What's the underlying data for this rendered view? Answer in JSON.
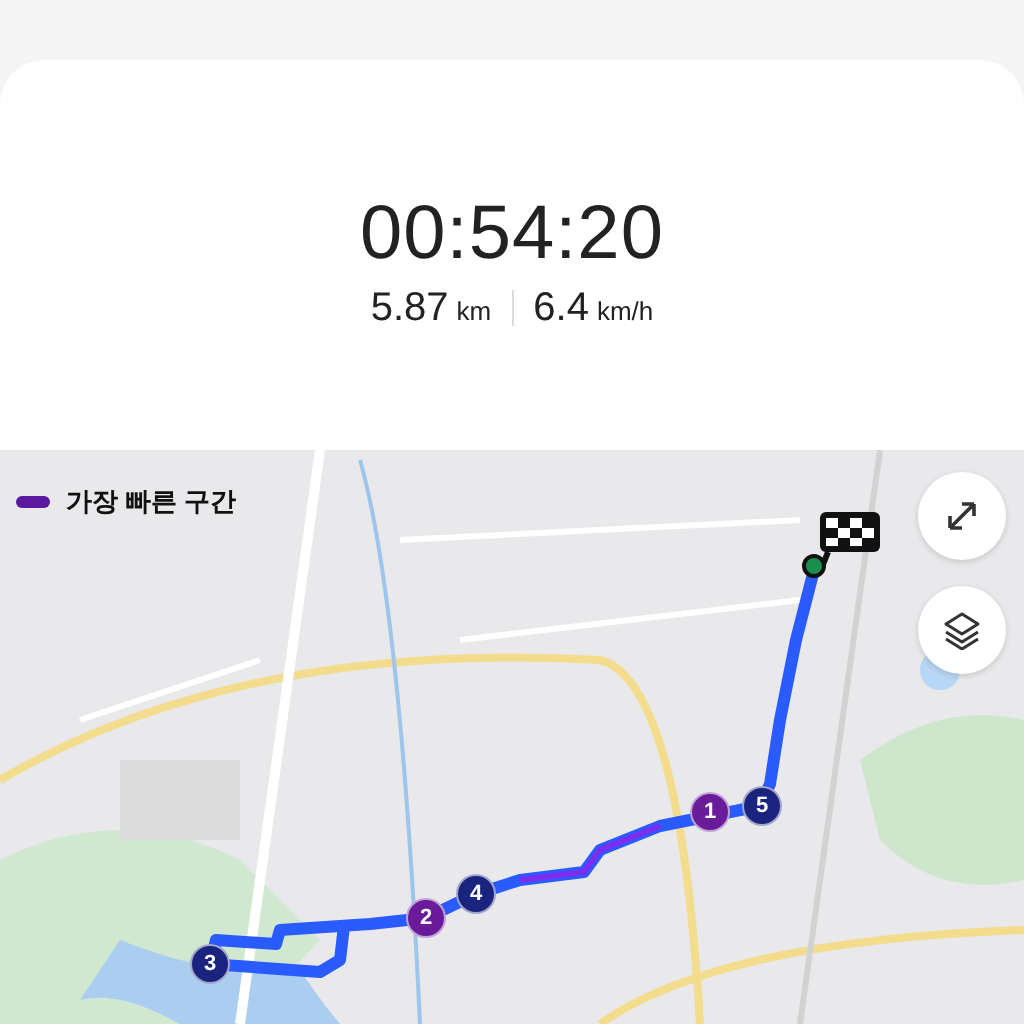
{
  "summary": {
    "duration": "00:54:20",
    "distance": "5.87",
    "distance_unit": "km",
    "speed": "6.4",
    "speed_unit": "km/h"
  },
  "map": {
    "kind": "picture",
    "legend": {
      "label": "가장 빠른 구간",
      "color": "#5b1a9e"
    },
    "markers": [
      {
        "label": "1",
        "color": "#6a1b9a"
      },
      {
        "label": "5",
        "color": "#1a237e"
      },
      {
        "label": "2",
        "color": "#6a1b9a"
      },
      {
        "label": "4",
        "color": "#1a237e"
      },
      {
        "label": "3",
        "color": "#1a237e"
      }
    ]
  }
}
